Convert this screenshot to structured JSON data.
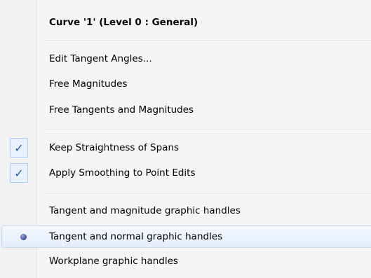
{
  "menu": {
    "title": "Curve '1' (Level 0 : General)",
    "group1": [
      {
        "label": "Edit Tangent Angles..."
      },
      {
        "label": "Free Magnitudes"
      },
      {
        "label": "Free Tangents and Magnitudes"
      }
    ],
    "group2": [
      {
        "label": "Keep Straightness of Spans",
        "checked": true
      },
      {
        "label": "Apply Smoothing to Point Edits",
        "checked": true
      }
    ],
    "group3": [
      {
        "label": "Tangent and magnitude graphic handles",
        "selected": false
      },
      {
        "label": "Tangent and normal graphic handles",
        "selected": true
      },
      {
        "label": "Workplane graphic handles",
        "selected": false
      }
    ],
    "check_glyph": "✓",
    "colors": {
      "background": "#f5f5f5",
      "checkmark": "#2a57a8",
      "highlight_border": "#c4d9f3"
    }
  }
}
